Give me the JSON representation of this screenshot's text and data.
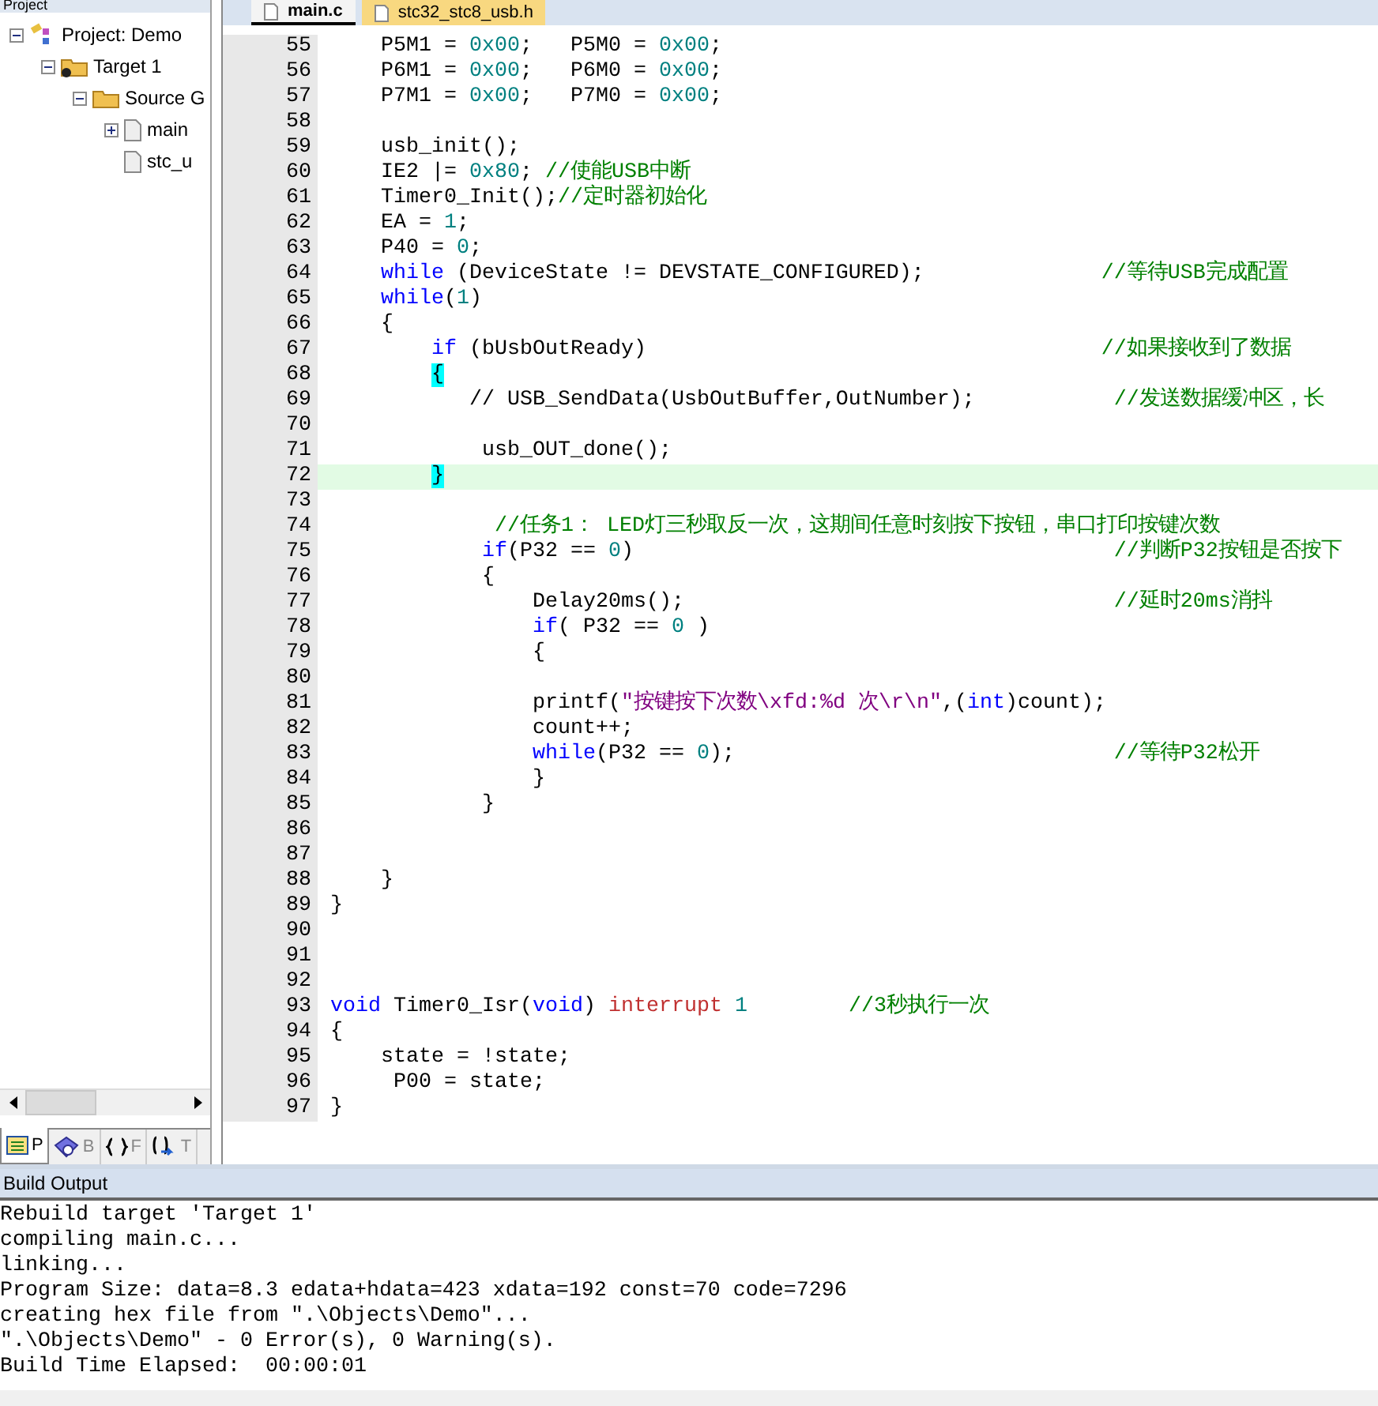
{
  "tabs": [
    {
      "label": "main.c",
      "selected": true
    },
    {
      "label": "stc32_stc8_usb.h",
      "selected": false
    }
  ],
  "project_panel": {
    "title": "Project",
    "tree": [
      {
        "label": "Project: Demo",
        "kind": "project",
        "expanded": true,
        "children": [
          {
            "label": "Target 1",
            "kind": "target",
            "expanded": true,
            "children": [
              {
                "label": "Source G",
                "kind": "folder",
                "expanded": true,
                "children": [
                  {
                    "label": "main",
                    "kind": "file",
                    "expanded": false
                  },
                  {
                    "label": "stc_u",
                    "kind": "file"
                  }
                ]
              }
            ]
          }
        ]
      }
    ],
    "bottom_tabs": [
      {
        "label": "P",
        "kind": "project",
        "selected": true
      },
      {
        "label": "B",
        "kind": "books",
        "selected": false
      },
      {
        "label": "F",
        "kind": "functions",
        "selected": false
      },
      {
        "label": "T",
        "kind": "templates",
        "selected": false
      }
    ]
  },
  "editor": {
    "lines": [
      {
        "number": "55",
        "tokens": [
          {
            "kind": "plain",
            "text": "    P5M1 = "
          },
          {
            "kind": "num",
            "text": "0x00"
          },
          {
            "kind": "plain",
            "text": ";   P5M0 = "
          },
          {
            "kind": "num",
            "text": "0x00"
          },
          {
            "kind": "plain",
            "text": ";"
          }
        ]
      },
      {
        "number": "56",
        "tokens": [
          {
            "kind": "plain",
            "text": "    P6M1 = "
          },
          {
            "kind": "num",
            "text": "0x00"
          },
          {
            "kind": "plain",
            "text": ";   P6M0 = "
          },
          {
            "kind": "num",
            "text": "0x00"
          },
          {
            "kind": "plain",
            "text": ";"
          }
        ]
      },
      {
        "number": "57",
        "tokens": [
          {
            "kind": "plain",
            "text": "    P7M1 = "
          },
          {
            "kind": "num",
            "text": "0x00"
          },
          {
            "kind": "plain",
            "text": ";   P7M0 = "
          },
          {
            "kind": "num",
            "text": "0x00"
          },
          {
            "kind": "plain",
            "text": ";"
          }
        ]
      },
      {
        "number": "58"
      },
      {
        "number": "59",
        "tokens": [
          {
            "kind": "plain",
            "text": "    usb_init();"
          }
        ]
      },
      {
        "number": "60",
        "tokens": [
          {
            "kind": "plain",
            "text": "    IE2 |= "
          },
          {
            "kind": "num",
            "text": "0x80"
          },
          {
            "kind": "plain",
            "text": "; "
          },
          {
            "kind": "cm",
            "text": "//使能USB中断"
          }
        ]
      },
      {
        "number": "61",
        "tokens": [
          {
            "kind": "plain",
            "text": "    Timer0_Init();"
          },
          {
            "kind": "cm",
            "text": "//定时器初始化"
          }
        ]
      },
      {
        "number": "62",
        "tokens": [
          {
            "kind": "plain",
            "text": "    EA = "
          },
          {
            "kind": "num",
            "text": "1"
          },
          {
            "kind": "plain",
            "text": ";"
          }
        ]
      },
      {
        "number": "63",
        "tokens": [
          {
            "kind": "plain",
            "text": "    P40 = "
          },
          {
            "kind": "num",
            "text": "0"
          },
          {
            "kind": "plain",
            "text": ";"
          }
        ]
      },
      {
        "number": "64",
        "tokens": [
          {
            "kind": "kw",
            "text": "    while"
          },
          {
            "kind": "plain",
            "text": " (DeviceState != DEVSTATE_CONFIGURED);              "
          },
          {
            "kind": "cm",
            "text": "//等待USB完成配置"
          }
        ]
      },
      {
        "number": "65",
        "tokens": [
          {
            "kind": "kw",
            "text": "    while"
          },
          {
            "kind": "plain",
            "text": "("
          },
          {
            "kind": "num",
            "text": "1"
          },
          {
            "kind": "plain",
            "text": ")"
          }
        ]
      },
      {
        "number": "66",
        "tokens": [
          {
            "kind": "plain",
            "text": "    {"
          }
        ]
      },
      {
        "number": "67",
        "tokens": [
          {
            "kind": "kw",
            "text": "        if"
          },
          {
            "kind": "plain",
            "text": " (bUsbOutReady)                                    "
          },
          {
            "kind": "cm",
            "text": "//如果接收到了数据"
          }
        ]
      },
      {
        "number": "68",
        "tokens": [
          {
            "kind": "brace",
            "text": "{"
          }
        ]
      },
      {
        "number": "69",
        "tokens": [
          {
            "kind": "plain",
            "text": "           // USB_SendData(UsbOutBuffer,OutNumber);           "
          },
          {
            "kind": "cm",
            "text": "//发送数据缓冲区，长"
          }
        ]
      },
      {
        "number": "70"
      },
      {
        "number": "71",
        "tokens": [
          {
            "kind": "plain",
            "text": "            usb_OUT_done();"
          }
        ]
      },
      {
        "number": "72",
        "current": true,
        "tokens": [
          {
            "kind": "brace",
            "text": "}"
          }
        ]
      },
      {
        "number": "73"
      },
      {
        "number": "74",
        "tokens": [
          {
            "kind": "cm",
            "text": "             //任务1： LED灯三秒取反一次，这期间任意时刻按下按钮，串口打印按键次数"
          }
        ]
      },
      {
        "number": "75",
        "tokens": [
          {
            "kind": "kw",
            "text": "            if"
          },
          {
            "kind": "plain",
            "text": "(P32 == "
          },
          {
            "kind": "num",
            "text": "0"
          },
          {
            "kind": "plain",
            "text": ")                                      "
          },
          {
            "kind": "cm",
            "text": "//判断P32按钮是否按下"
          }
        ]
      },
      {
        "number": "76",
        "tokens": [
          {
            "kind": "plain",
            "text": "            {"
          }
        ]
      },
      {
        "number": "77",
        "tokens": [
          {
            "kind": "plain",
            "text": "                Delay20ms();                                  "
          },
          {
            "kind": "cm",
            "text": "//延时20ms消抖"
          }
        ]
      },
      {
        "number": "78",
        "tokens": [
          {
            "kind": "kw",
            "text": "                if"
          },
          {
            "kind": "plain",
            "text": "( P32 == "
          },
          {
            "kind": "num",
            "text": "0"
          },
          {
            "kind": "plain",
            "text": " )"
          }
        ]
      },
      {
        "number": "79",
        "tokens": [
          {
            "kind": "plain",
            "text": "                {"
          }
        ]
      },
      {
        "number": "80"
      },
      {
        "number": "81",
        "tokens": [
          {
            "kind": "plain",
            "text": "                printf("
          },
          {
            "kind": "str",
            "text": "\"按键按下次数\\xfd:%d 次\\r\\n\""
          },
          {
            "kind": "plain",
            "text": ",("
          },
          {
            "kind": "kw",
            "text": "int"
          },
          {
            "kind": "plain",
            "text": ")count);"
          }
        ]
      },
      {
        "number": "82",
        "tokens": [
          {
            "kind": "plain",
            "text": "                count++;"
          }
        ]
      },
      {
        "number": "83",
        "tokens": [
          {
            "kind": "kw",
            "text": "                while"
          },
          {
            "kind": "plain",
            "text": "(P32 == "
          },
          {
            "kind": "num",
            "text": "0"
          },
          {
            "kind": "plain",
            "text": ");                              "
          },
          {
            "kind": "cm",
            "text": "//等待P32松开"
          }
        ]
      },
      {
        "number": "84",
        "tokens": [
          {
            "kind": "plain",
            "text": "                }"
          }
        ]
      },
      {
        "number": "85",
        "tokens": [
          {
            "kind": "plain",
            "text": "            }"
          }
        ]
      },
      {
        "number": "86"
      },
      {
        "number": "87"
      },
      {
        "number": "88",
        "tokens": [
          {
            "kind": "plain",
            "text": "    }"
          }
        ]
      },
      {
        "number": "89",
        "tokens": [
          {
            "kind": "plain",
            "text": "}"
          }
        ]
      },
      {
        "number": "90"
      },
      {
        "number": "91"
      },
      {
        "number": "92"
      },
      {
        "number": "93",
        "tokens": [
          {
            "kind": "kw",
            "text": "void"
          },
          {
            "kind": "plain",
            "text": " Timer0_Isr("
          },
          {
            "kind": "kw",
            "text": "void"
          },
          {
            "kind": "plain",
            "text": ") "
          },
          {
            "kind": "c51",
            "text": "interrupt "
          },
          {
            "kind": "num",
            "text": "1"
          },
          {
            "kind": "cm",
            "text": "        //3秒执行一次"
          }
        ]
      },
      {
        "number": "94",
        "tokens": [
          {
            "kind": "plain",
            "text": "{"
          }
        ]
      },
      {
        "number": "95",
        "tokens": [
          {
            "kind": "plain",
            "text": "    state = !state;"
          }
        ]
      },
      {
        "number": "96",
        "tokens": [
          {
            "kind": "plain",
            "text": "     P00 = state;"
          }
        ]
      },
      {
        "number": "97",
        "tokens": [
          {
            "kind": "plain",
            "text": "}"
          }
        ]
      }
    ]
  },
  "build_output": {
    "title": "Build Output",
    "lines": [
      "Rebuild target 'Target 1'",
      "compiling main.c...",
      "linking...",
      "Program Size: data=8.3 edata+hdata=423 xdata=192 const=70 code=7296",
      "creating hex file from \".\\Objects\\Demo\"...",
      "\".\\Objects\\Demo\" - 0 Error(s), 0 Warning(s).",
      "Build Time Elapsed:  00:00:01"
    ]
  }
}
